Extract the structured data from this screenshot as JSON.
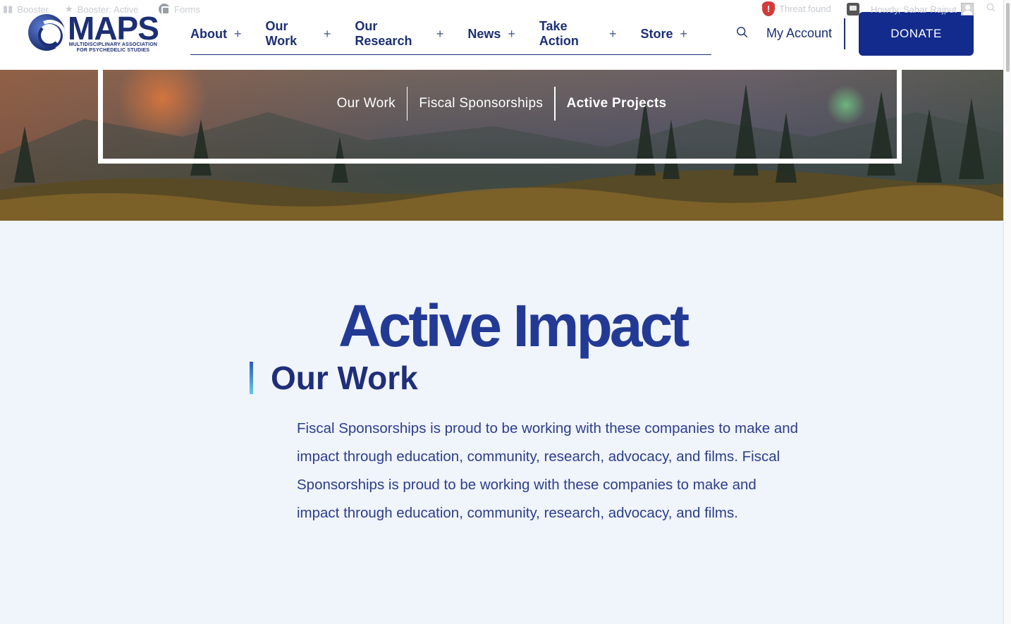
{
  "adminbar": {
    "item1": "Booster",
    "item2": "Booster: Active",
    "item3": "Forms",
    "threat": "Threat found",
    "howdy": "Howdy, Sahar Rajput"
  },
  "logo": {
    "word": "MAPS",
    "sub_line1": "MULTIDISCIPLINARY ASSOCIATION",
    "sub_line2": "FOR PSYCHEDELIC STUDIES"
  },
  "nav": {
    "items": [
      {
        "label": "About"
      },
      {
        "label": "Our Work"
      },
      {
        "label": "Our Research"
      },
      {
        "label": "News"
      },
      {
        "label": "Take Action"
      },
      {
        "label": "Store"
      }
    ],
    "expand_glyph": "+"
  },
  "header": {
    "account_label": "My Account",
    "donate_label": "DONATE"
  },
  "breadcrumb": {
    "items": [
      "Our Work",
      "Fiscal Sponsorships",
      "Active Projects"
    ]
  },
  "main": {
    "title": "Active Impact",
    "section_label": "Our Work",
    "body": "Fiscal Sponsorships is proud to be working with these companies to make and impact through education, community, research, advocacy, and films. Fiscal Sponsorships is proud to be working with these companies to make and impact through education, community, research, advocacy, and films."
  },
  "colors": {
    "brand": "#1c2f74",
    "donate": "#122b8c",
    "title": "#233a95",
    "page_bg": "#f0f4fb"
  },
  "icons": [
    "threat-shield-icon",
    "chat-icon",
    "avatar-icon",
    "search-icon",
    "plus-icon"
  ]
}
